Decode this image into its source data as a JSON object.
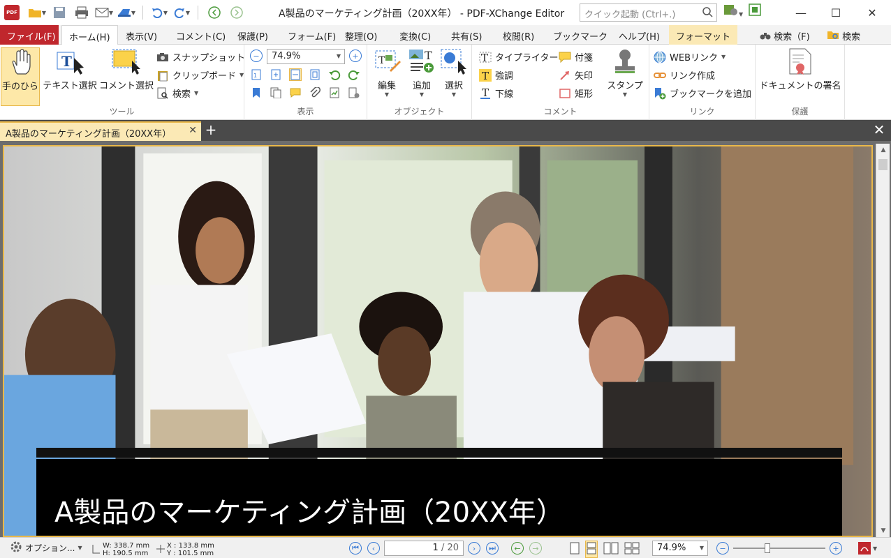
{
  "titlebar": {
    "app_icon_label": "PDF",
    "title": "A製品のマーケティング計画（20XX年） - PDF-XChange Editor",
    "quick_launch_placeholder": "クイック起動 (Ctrl+.)"
  },
  "menu": {
    "file": "ファイル(F)",
    "home": "ホーム(H)",
    "view": "表示(V)",
    "comment": "コメント(C)",
    "protect": "保護(P)",
    "form": "フォーム(F)",
    "organize": "整理(O)",
    "convert": "変換(C)",
    "share": "共有(S)",
    "review": "校閲(R)",
    "bookmark": "ブックマーク",
    "help": "ヘルプ(H)",
    "format": "フォーマット",
    "find": "検索（F)",
    "search": "検索"
  },
  "ribbon": {
    "tools": {
      "label": "ツール",
      "hand": "手のひら",
      "text_select": "テキスト選択",
      "comment_select": "コメント選択",
      "snapshot": "スナップショット",
      "clipboard": "クリップボード",
      "search": "検索"
    },
    "view": {
      "label": "表示",
      "zoom": "74.9%"
    },
    "objects": {
      "label": "オブジェクト",
      "edit": "編集",
      "add": "追加",
      "select": "選択"
    },
    "comment": {
      "label": "コメント",
      "typewriter": "タイプライター",
      "highlight": "強調",
      "underline": "下線",
      "sticky": "付箋",
      "arrow": "矢印",
      "rect": "矩形",
      "stamp": "スタンプ"
    },
    "links": {
      "label": "リンク",
      "web_link": "WEBリンク",
      "create_link": "リンク作成",
      "add_bookmark": "ブックマークを追加"
    },
    "protect": {
      "label": "保護",
      "sign": "ドキュメントの署名"
    }
  },
  "document": {
    "tab_title": "A製品のマーケティング計画（20XX年）",
    "cover_title": "A製品のマーケティング計画（20XX年）"
  },
  "statusbar": {
    "options": "オプション...",
    "width": "W: 338.7 mm",
    "height": "H: 190.5 mm",
    "x": "X : 133.8 mm",
    "y": "Y : 101.5 mm",
    "current_page": "1",
    "total_pages": "/ 20",
    "zoom": "74.9%"
  },
  "colors": {
    "accent_red": "#c0272d",
    "accent_yellow": "#fbe9b5",
    "icon_blue": "#3a7bd5"
  }
}
